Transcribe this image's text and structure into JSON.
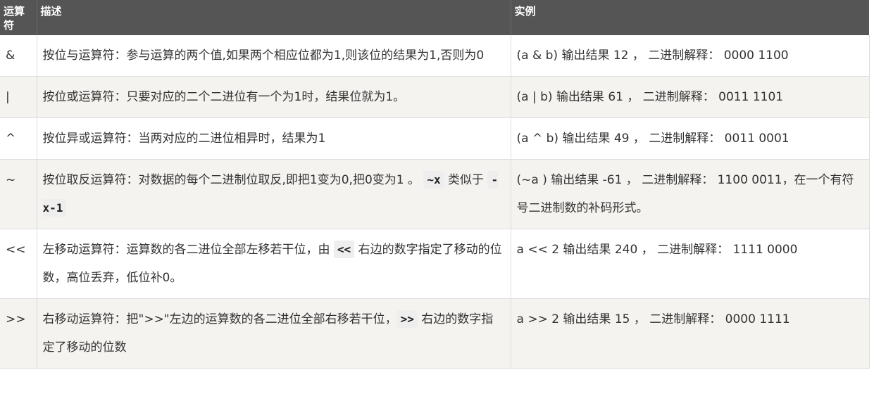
{
  "headers": {
    "op": "运算符",
    "desc": "描述",
    "example": "实例"
  },
  "rows": [
    {
      "op": "&",
      "desc": "按位与运算符：参与运算的两个值,如果两个相应位都为1,则该位的结果为1,否则为0",
      "example": "(a & b) 输出结果 12 ， 二进制解释： 0000 1100"
    },
    {
      "op": "|",
      "desc": "按位或运算符：只要对应的二个二进位有一个为1时，结果位就为1。",
      "example": "(a | b) 输出结果 61 ， 二进制解释： 0011 1101"
    },
    {
      "op": "^",
      "desc": "按位异或运算符：当两对应的二进位相异时，结果为1",
      "example": "(a ^ b) 输出结果 49 ， 二进制解释： 0011 0001"
    },
    {
      "op": "~",
      "desc_a": "按位取反运算符：对数据的每个二进制位取反,即把1变为0,把0变为1 。",
      "desc_code1": "~x",
      "desc_b": " 类似于 ",
      "desc_code2": "-x-1",
      "example": "(~a ) 输出结果 -61 ， 二进制解释： 1100 0011，在一个有符号二进制数的补码形式。"
    },
    {
      "op": "<<",
      "desc_a": "左移动运算符：运算数的各二进位全部左移若干位，由 ",
      "desc_code1": "<<",
      "desc_b": " 右边的数字指定了移动的位数，高位丢弃，低位补0。",
      "example": "a << 2 输出结果 240 ， 二进制解释： 1111 0000"
    },
    {
      "op": ">>",
      "desc_a": "右移动运算符：把\">>\"左边的运算数的各二进位全部右移若干位，",
      "desc_code1": ">>",
      "desc_b": " 右边的数字指定了移动的位数",
      "example": "a >> 2 输出结果 15 ， 二进制解释： 0000 1111"
    }
  ]
}
